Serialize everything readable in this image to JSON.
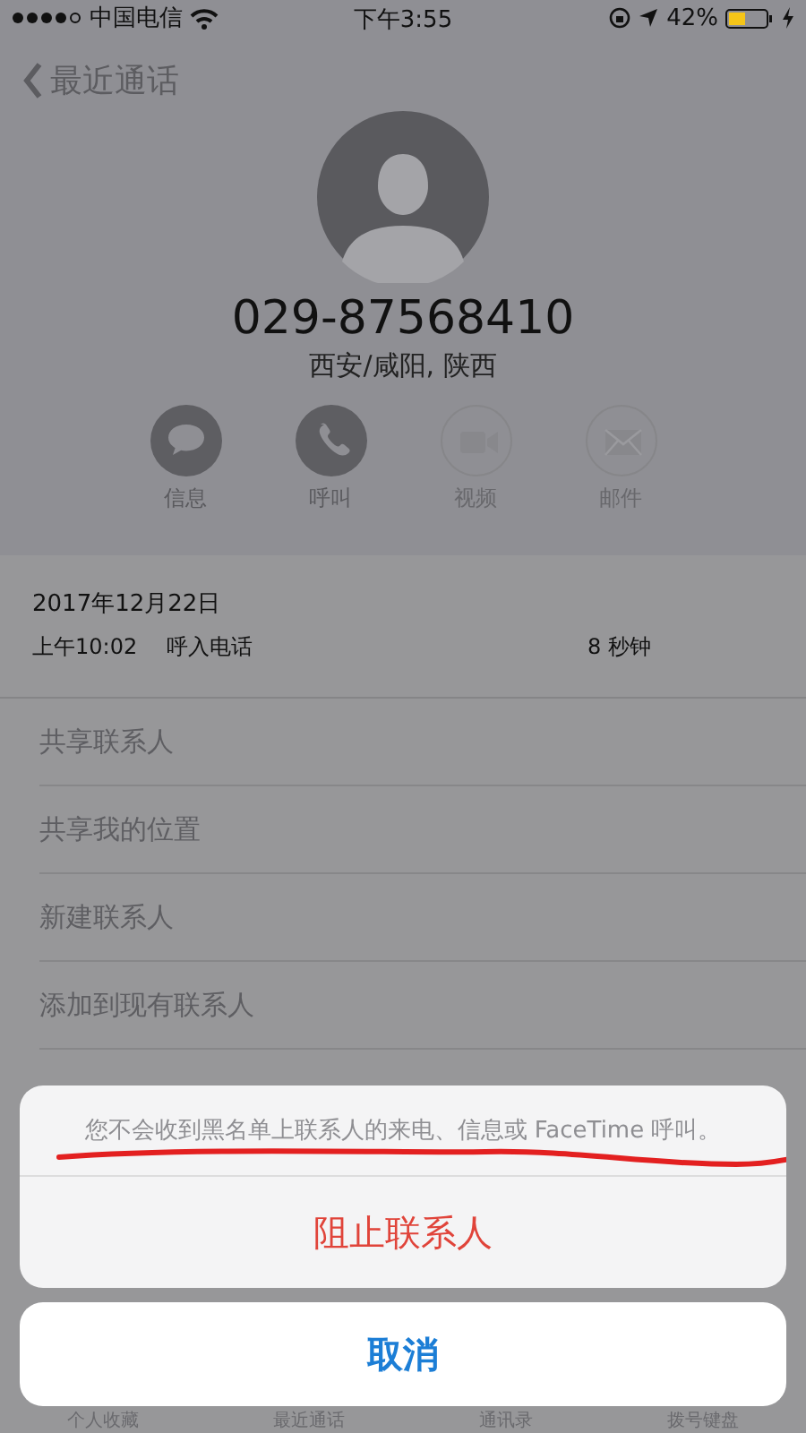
{
  "status_bar": {
    "carrier": "中国电信",
    "time": "下午3:55",
    "battery": "42%"
  },
  "nav": {
    "back": "最近通话"
  },
  "contact": {
    "number": "029-87568410",
    "location": "西安/咸阳, 陕西"
  },
  "actions": [
    {
      "kind": "message",
      "label": "信息",
      "disabled": false
    },
    {
      "kind": "call",
      "label": "呼叫",
      "disabled": false
    },
    {
      "kind": "video",
      "label": "视频",
      "disabled": true
    },
    {
      "kind": "mail",
      "label": "邮件",
      "disabled": true
    }
  ],
  "call_log": {
    "date": "2017年12月22日",
    "time": "上午10:02",
    "type": "呼入电话",
    "duration": "8 秒钟"
  },
  "menu": [
    "共享联系人",
    "共享我的位置",
    "新建联系人",
    "添加到现有联系人"
  ],
  "action_sheet": {
    "message": "您不会收到黑名单上联系人的来电、信息或 FaceTime 呼叫。",
    "destructive": "阻止联系人",
    "cancel": "取消"
  },
  "tab_bar": [
    "个人收藏",
    "最近通话",
    "通讯录",
    "拨号键盘"
  ]
}
